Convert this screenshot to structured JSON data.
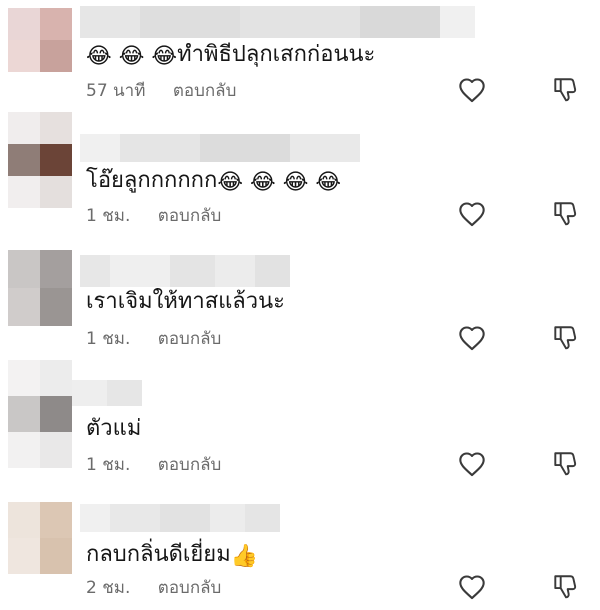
{
  "comments": [
    {
      "text": "ทำพิธีปลุกเสกก่อนนะ",
      "emoji": "😂 😂 😂 ",
      "emoji_icon": "laughing-tears-emoji",
      "time": "57 นาที",
      "reply": "ตอบกลับ"
    },
    {
      "text": "โอ๊ยลูกกกกกก",
      "emoji": " 😂 😂 😂 😂",
      "emoji_icon": "laughing-tears-emoji",
      "time": "1 ชม.",
      "reply": "ตอบกลับ"
    },
    {
      "text": "เราเจิมให้ทาสแล้วนะ",
      "emoji": "",
      "time": "1 ชม.",
      "reply": "ตอบกลับ"
    },
    {
      "text": "ตัวแม่",
      "emoji": "",
      "time": "1 ชม.",
      "reply": "ตอบกลับ"
    },
    {
      "text": "กลบกลิ่นดีเยี่ยม",
      "emoji": " 👍",
      "emoji_icon": "thumbs-up-emoji",
      "time": "2 ชม.",
      "reply": "ตอบกลับ"
    }
  ],
  "icons": {
    "like": "heart-icon",
    "dislike": "thumbs-down-icon"
  },
  "colors": {
    "text": "#161616",
    "meta": "#6b6b6b",
    "icon": "#3a3a3a"
  }
}
